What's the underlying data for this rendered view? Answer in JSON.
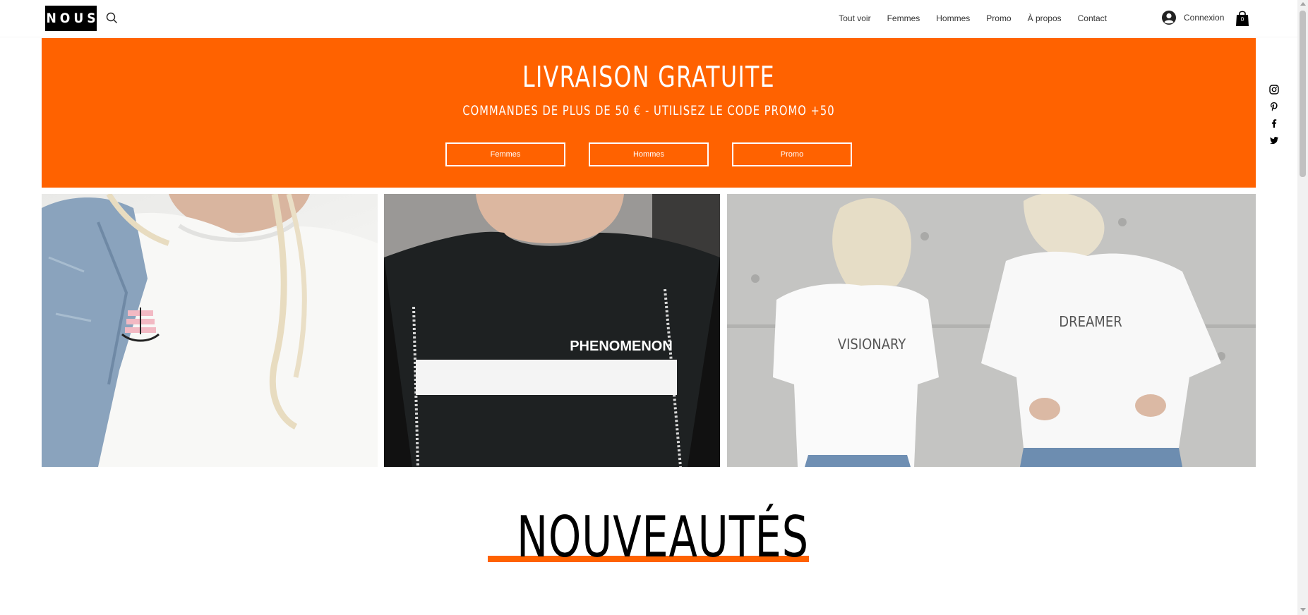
{
  "header": {
    "logo_text": "NOUS",
    "nav": [
      "Tout voir",
      "Femmes",
      "Hommes",
      "Promo",
      "À propos",
      "Contact"
    ],
    "login_label": "Connexion",
    "cart_count": "0"
  },
  "banner": {
    "title": "LIVRAISON GRATUITE",
    "subtitle": "COMMANDES DE PLUS DE 50 € - UTILISEZ LE CODE PROMO +50",
    "buttons": [
      "Femmes",
      "Hommes",
      "Promo"
    ],
    "color": "#ff6200"
  },
  "social": [
    "instagram-icon",
    "pinterest-icon",
    "facebook-icon",
    "twitter-icon"
  ],
  "photos": {
    "shirt_2_text": "PHENOMENON",
    "shirt_3_left_text": "VISIONARY",
    "shirt_3_right_text": "DREAMER"
  },
  "section": {
    "title": "NOUVEAUTÉS"
  }
}
